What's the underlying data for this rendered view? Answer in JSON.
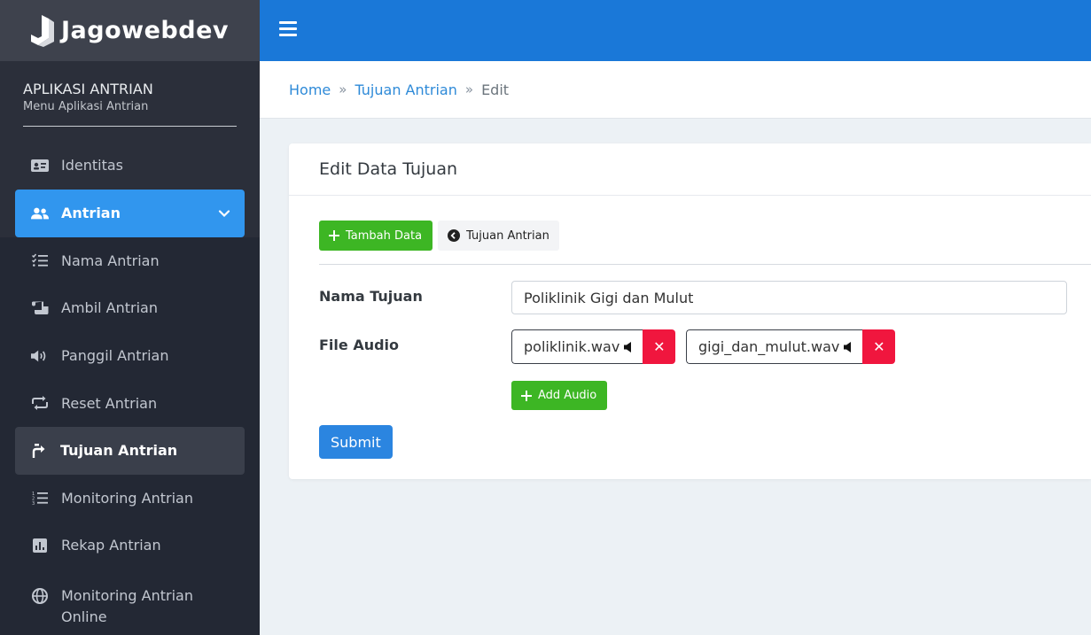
{
  "brand": {
    "name": "Jagowebdev"
  },
  "sidebar": {
    "app_title": "APLIKASI ANTRIAN",
    "app_subtitle": "Menu Aplikasi Antrian",
    "items": [
      {
        "label": "Identitas",
        "icon": "id-card-icon"
      },
      {
        "label": "Antrian",
        "icon": "users-icon"
      },
      {
        "label": "Nama Antrian",
        "icon": "list-check-icon"
      },
      {
        "label": "Ambil Antrian",
        "icon": "ticket-icon"
      },
      {
        "label": "Panggil Antrian",
        "icon": "volume-icon"
      },
      {
        "label": "Reset Antrian",
        "icon": "repeat-icon"
      },
      {
        "label": "Tujuan Antrian",
        "icon": "directions-icon"
      },
      {
        "label": "Monitoring Antrian",
        "icon": "list-ordered-icon"
      },
      {
        "label": "Rekap Antrian",
        "icon": "chart-icon"
      },
      {
        "label": "Monitoring Antrian Online",
        "icon": "globe-icon"
      }
    ]
  },
  "breadcrumb": {
    "home": "Home",
    "section": "Tujuan Antrian",
    "current": "Edit",
    "separator": "»"
  },
  "card": {
    "title": "Edit Data Tujuan",
    "add_button": "Tambah Data",
    "back_button": "Tujuan Antrian",
    "name_label": "Nama Tujuan",
    "name_value": "Poliklinik Gigi dan Mulut",
    "audio_label": "File Audio",
    "audio_files": [
      "poliklinik.wav",
      "gigi_dan_mulut.wav"
    ],
    "delete_symbol": "✕",
    "add_audio_button": "Add Audio",
    "submit_button": "Submit"
  },
  "colors": {
    "topbar": "#1a78d8",
    "sidebar": "#2b2f3a",
    "active_parent": "#3196ee",
    "success": "#3db624",
    "danger": "#f0163e",
    "primary": "#2b85e0"
  }
}
